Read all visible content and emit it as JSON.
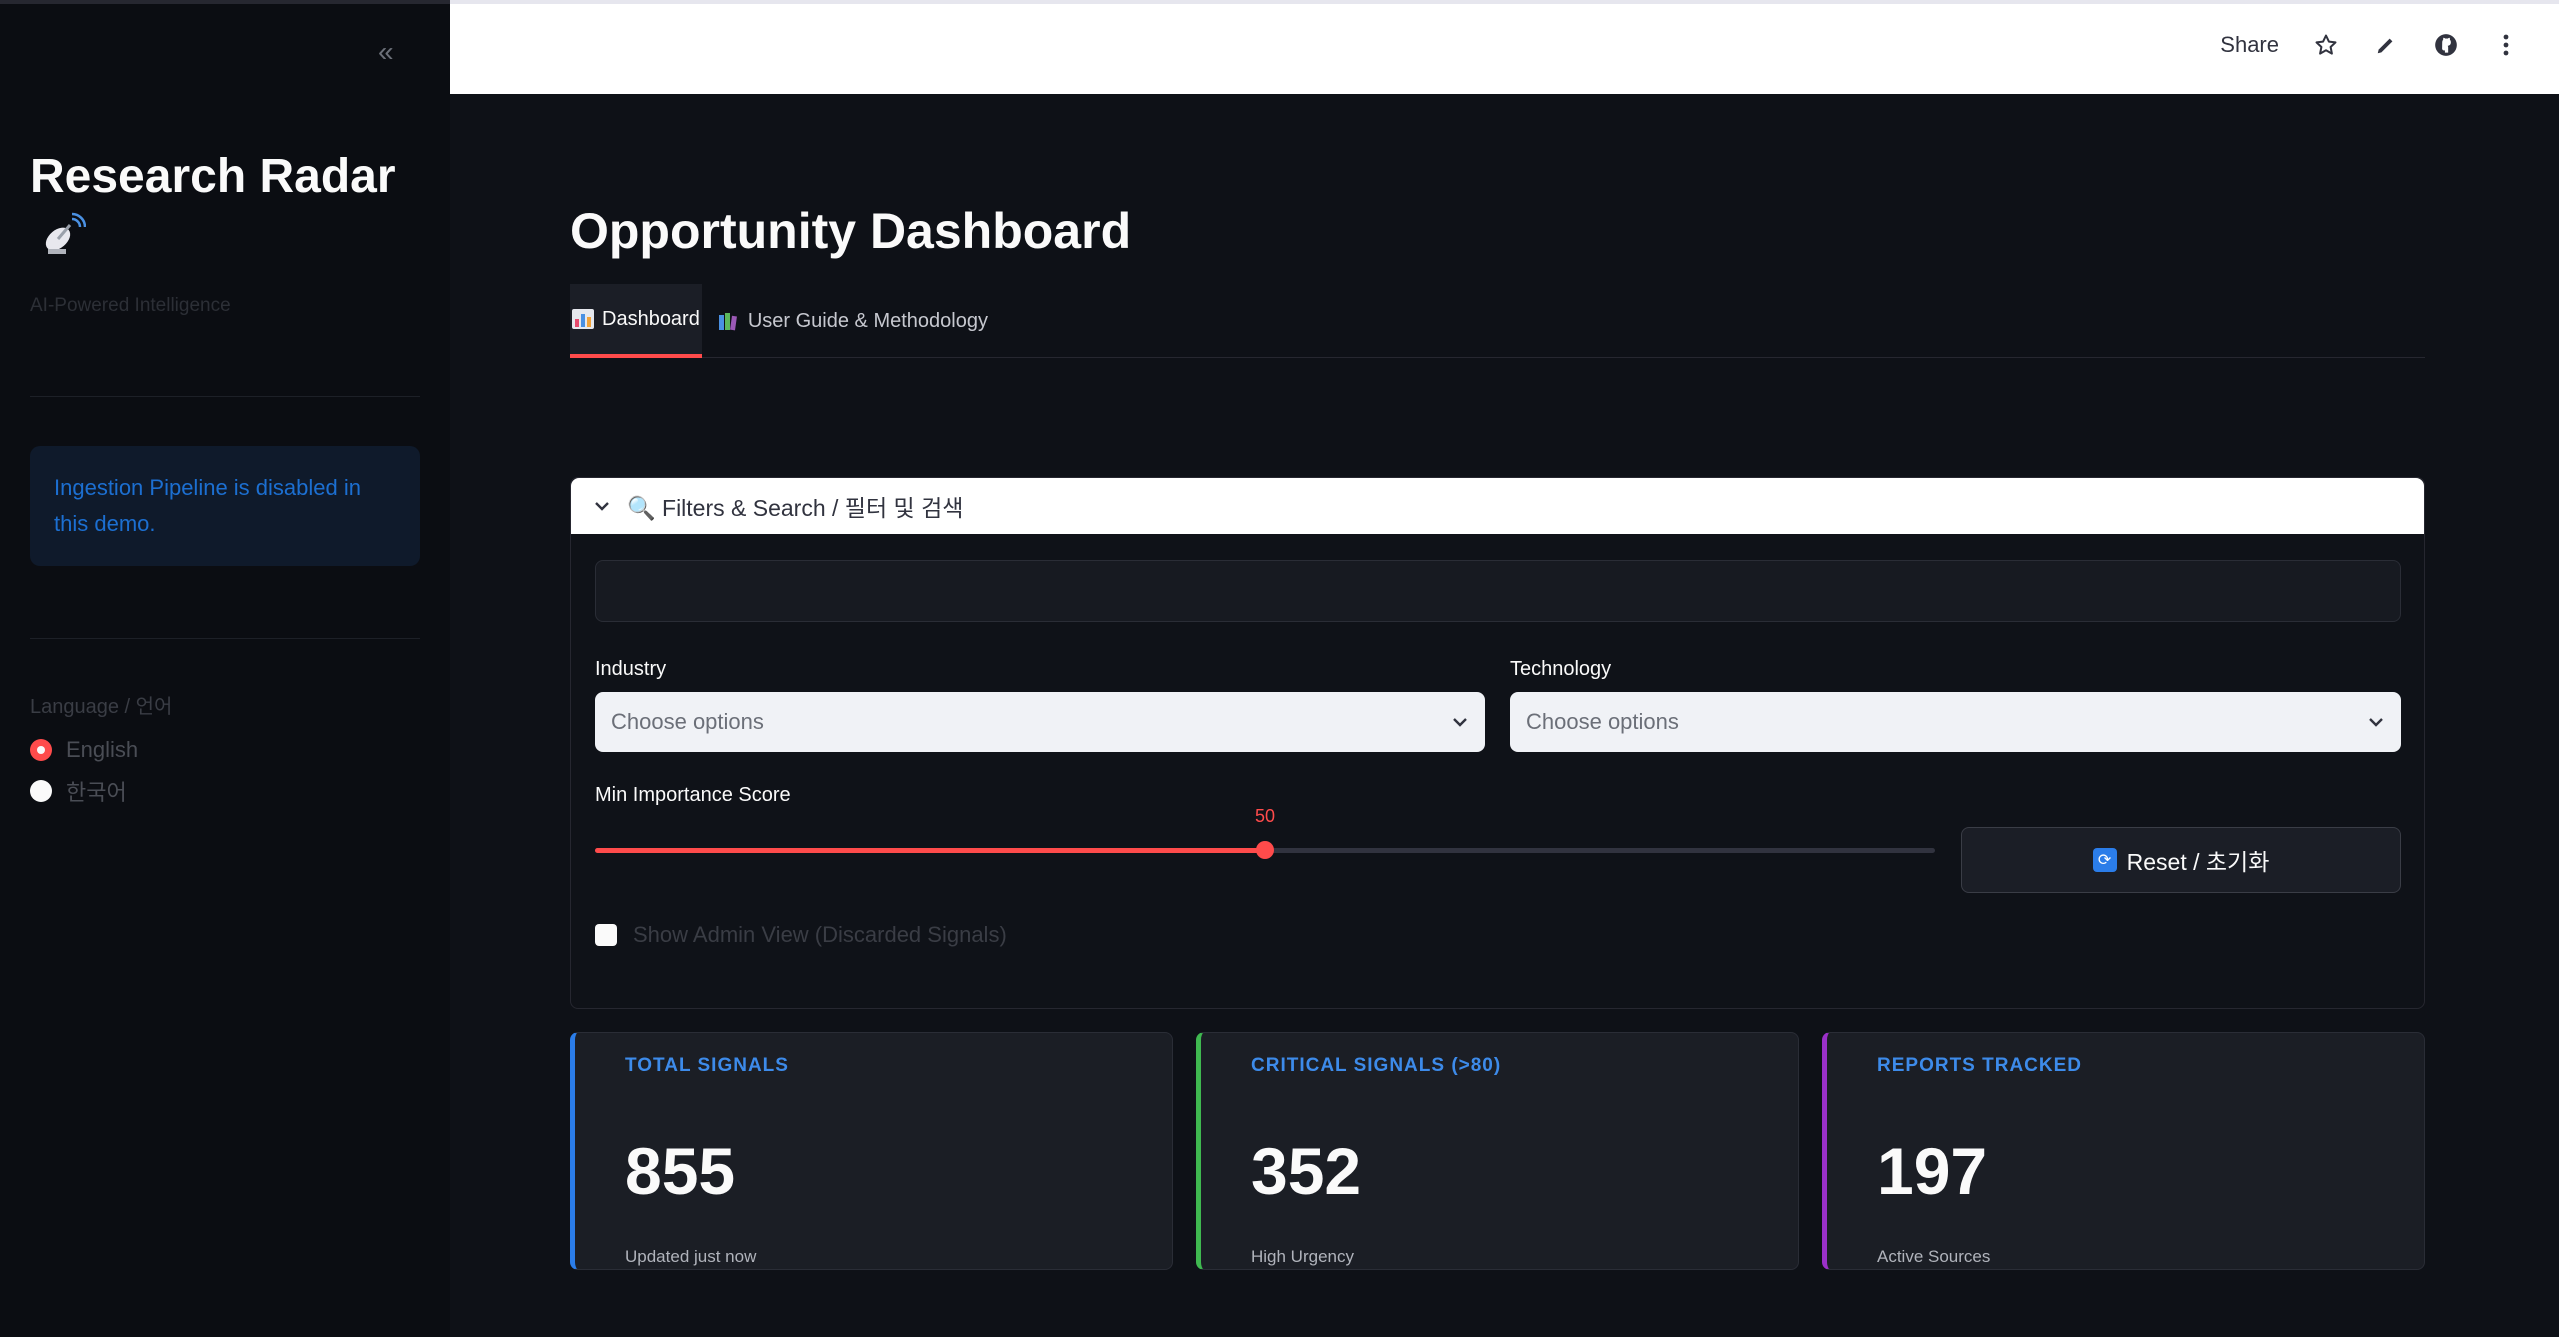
{
  "sidebar": {
    "collapse_glyph": "«",
    "title": "Research Radar",
    "subtitle": "AI-Powered Intelligence",
    "info_text": "Ingestion Pipeline is disabled in this demo.",
    "language_label": "Language / 언어",
    "language_options": [
      "English",
      "한국어"
    ],
    "language_selected": "English"
  },
  "header": {
    "share_label": "Share",
    "icons": [
      "star-icon",
      "pencil-icon",
      "github-icon",
      "kebab-menu-icon"
    ]
  },
  "main": {
    "page_title": "Opportunity Dashboard",
    "tabs": [
      {
        "label": "Dashboard",
        "icon": "bar-chart-icon",
        "active": true
      },
      {
        "label": "User Guide & Methodology",
        "icon": "books-icon",
        "active": false
      }
    ],
    "filters": {
      "header_label": "🔍 Filters & Search / 필터 및 검색",
      "search_value": "",
      "industry_label": "Industry",
      "industry_placeholder": "Choose options",
      "technology_label": "Technology",
      "technology_placeholder": "Choose options",
      "min_score_label": "Min Importance Score",
      "min_score_value": "50",
      "min_score_fraction": 0.5,
      "reset_label": "Reset / 초기화",
      "admin_label": "Show Admin View (Discarded Signals)"
    },
    "metrics": [
      {
        "label": "TOTAL SIGNALS",
        "value": "855",
        "sub": "Updated just now",
        "accent": "#2b7de9"
      },
      {
        "label": "CRITICAL SIGNALS (>80)",
        "value": "352",
        "sub": "High Urgency",
        "accent": "#3fb950"
      },
      {
        "label": "REPORTS TRACKED",
        "value": "197",
        "sub": "Active Sources",
        "accent": "#9b30c9"
      }
    ]
  },
  "colors": {
    "primary": "#ff4b4b",
    "info_text": "#1c6fd1",
    "metric_label": "#3d8bea"
  }
}
